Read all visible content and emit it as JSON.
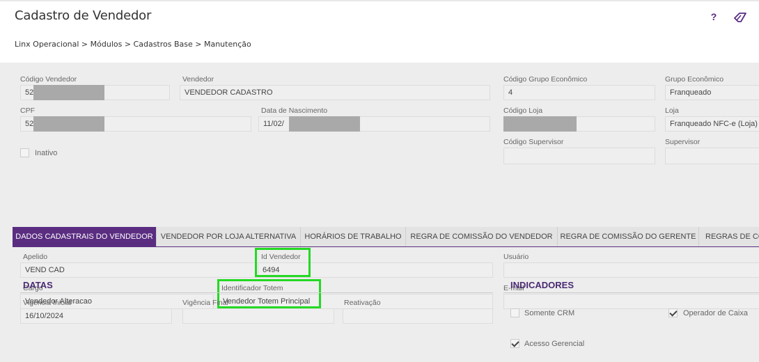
{
  "header": {
    "title": "Cadastro de Vendedor",
    "help_label": "?",
    "breadcrumb": "Linx Operacional  >  Módulos  >  Cadastros Base  >  Manutenção"
  },
  "top_form": {
    "codigo_vendedor": {
      "label": "Código Vendedor",
      "value": "52"
    },
    "vendedor": {
      "label": "Vendedor",
      "value": "VENDEDOR CADASTRO"
    },
    "codigo_grupo": {
      "label": "Código Grupo Econômico",
      "value": "4"
    },
    "grupo": {
      "label": "Grupo Econômico",
      "value": "Franqueado"
    },
    "cpf": {
      "label": "CPF",
      "value": "52"
    },
    "data_nascimento": {
      "label": "Data de Nascimento",
      "value": "11/02/"
    },
    "codigo_loja": {
      "label": "Código Loja",
      "value": ""
    },
    "loja": {
      "label": "Loja",
      "value": "Franqueado NFC-e (Loja)"
    },
    "inativo": {
      "label": "Inativo",
      "checked": false
    },
    "codigo_supervisor": {
      "label": "Código Supervisor",
      "value": ""
    },
    "supervisor": {
      "label": "Supervisor",
      "value": ""
    }
  },
  "tabs": [
    {
      "label": "DADOS CADASTRAIS DO VENDEDOR",
      "active": true
    },
    {
      "label": "VENDEDOR POR LOJA ALTERNATIVA",
      "active": false
    },
    {
      "label": "HORÁRIOS DE TRABALHO",
      "active": false
    },
    {
      "label": "REGRA DE COMISSÃO DO VENDEDOR",
      "active": false
    },
    {
      "label": "REGRA DE COMISSÃO DO GERENTE",
      "active": false
    },
    {
      "label": "REGRAS DE CO",
      "active": false
    }
  ],
  "detail_form": {
    "apelido": {
      "label": "Apelido",
      "value": "VEND CAD"
    },
    "id_vendedor": {
      "label": "Id Vendedor",
      "value": "6494"
    },
    "usuario": {
      "label": "Usuário",
      "value": ""
    },
    "cargo": {
      "label": "Cargo",
      "value": "Vendedor Alteracao"
    },
    "identificador_totem": {
      "label": "Identificador Totem",
      "value": "Vendedor Totem Principal"
    },
    "email": {
      "label": "E-mail",
      "value": ""
    }
  },
  "datas": {
    "title": "DATAS",
    "vigencia_inicial": {
      "label": "Vigência Inicial",
      "value": "16/10/2024"
    },
    "vigencia_final": {
      "label": "Vigência Final",
      "value": ""
    },
    "reativacao": {
      "label": "Reativação",
      "value": ""
    }
  },
  "indicadores": {
    "title": "INDICADORES",
    "somente_crm": {
      "label": "Somente CRM",
      "checked": false
    },
    "operador_caixa": {
      "label": "Operador de Caixa",
      "checked": true
    },
    "acesso_gerencial": {
      "label": "Acesso Gerencial",
      "checked": true
    }
  },
  "colors": {
    "accent": "#5a2d81",
    "highlight": "#23d923",
    "section_title": "#4a2a73"
  }
}
